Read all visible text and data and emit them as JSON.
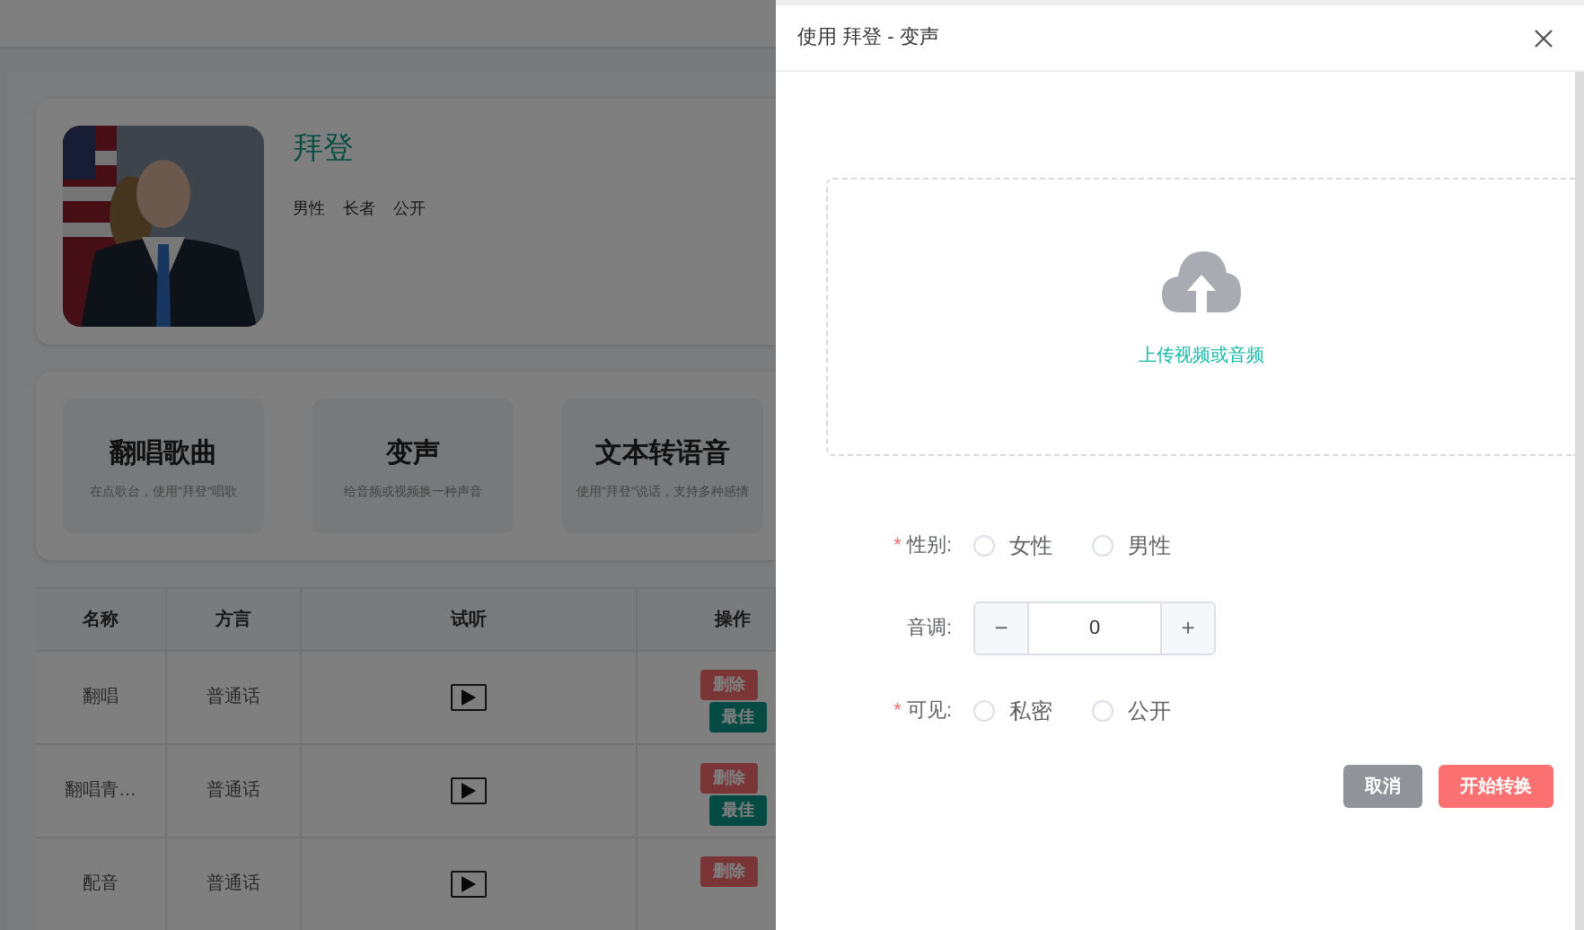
{
  "profile": {
    "name": "拜登",
    "tags": [
      "男性",
      "长者",
      "公开"
    ]
  },
  "features": [
    {
      "title": "翻唱歌曲",
      "description": "在点歌台，使用\"拜登\"唱歌"
    },
    {
      "title": "变声",
      "description": "给音频或视频换一种声音"
    },
    {
      "title": "文本转语音",
      "description": "使用\"拜登\"说话，支持多种感情"
    }
  ],
  "table": {
    "columns": [
      "名称",
      "方言",
      "试听",
      "操作"
    ],
    "rows": [
      {
        "name": "翻唱",
        "dialect": "普通话",
        "actions": [
          "删除",
          "最佳"
        ]
      },
      {
        "name": "翻唱青…",
        "dialect": "普通话",
        "actions": [
          "删除",
          "最佳"
        ]
      },
      {
        "name": "配音",
        "dialect": "普通话",
        "actions": [
          "删除"
        ]
      }
    ]
  },
  "drawer": {
    "title": "使用 拜登 - 变声",
    "upload": {
      "label": "上传视频或音频"
    },
    "fields": [
      {
        "kind": "radio",
        "label": "性别:",
        "required_mark": "*",
        "options": [
          {
            "label": "女性",
            "selected": false
          },
          {
            "label": "男性",
            "selected": false
          }
        ]
      },
      {
        "kind": "stepper",
        "label": "音调:",
        "value": "0",
        "minus": "−",
        "plus": "+"
      },
      {
        "kind": "radio",
        "label": "可见:",
        "required_mark": "*",
        "options": [
          {
            "label": "私密",
            "selected": false
          },
          {
            "label": "公开",
            "selected": false
          }
        ]
      }
    ],
    "buttons": [
      {
        "label": "取消",
        "kind": "secondary"
      },
      {
        "label": "开始转换",
        "kind": "primary"
      }
    ]
  }
}
